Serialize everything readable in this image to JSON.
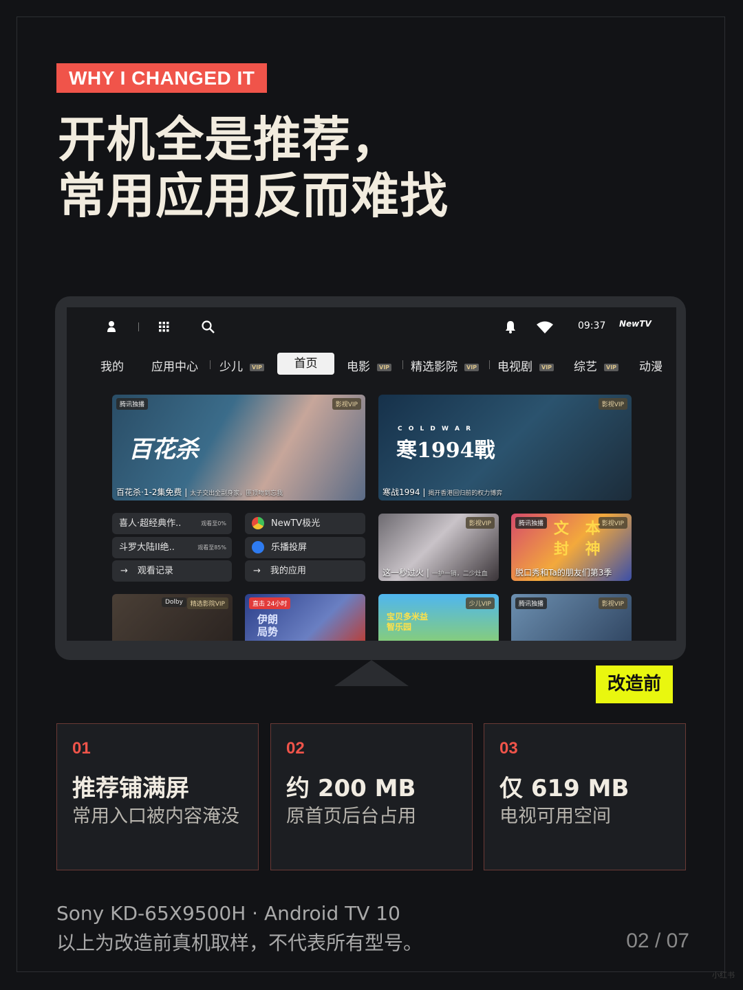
{
  "header": {
    "tag": "WHY I CHANGED IT",
    "headline_line1": "开机全是推荐，",
    "headline_line2": "常用应用反而难找"
  },
  "tv": {
    "status": {
      "time": "09:37",
      "brand": "NewTV"
    },
    "tabs": [
      {
        "label": "我的",
        "vip": ""
      },
      {
        "label": "应用中心",
        "vip": ""
      },
      {
        "label": "少儿",
        "vip": "VIP"
      },
      {
        "label": "首页",
        "vip": "",
        "active": true
      },
      {
        "label": "电影",
        "vip": "VIP"
      },
      {
        "label": "精选影院",
        "vip": "VIP"
      },
      {
        "label": "电视剧",
        "vip": "VIP"
      },
      {
        "label": "综艺",
        "vip": "VIP"
      },
      {
        "label": "动漫",
        "vip": ""
      }
    ],
    "hero_cards": [
      {
        "badge_left": "腾讯独播",
        "badge_right": "影视VIP",
        "poster_text": "百花杀",
        "caption": "百花杀·1-2集免费",
        "caption_sub": "太子交出全副身家，匪顶吻到忘我"
      },
      {
        "badge_right": "影视VIP",
        "poster_text": "寒1994戰",
        "poster_small": "C O L D   W A R",
        "caption": "寒战1994",
        "caption_sub": "揭开香港回归前的权力博弈"
      }
    ],
    "history": [
      {
        "label": "喜人·超经典作..",
        "progress": "观看至0%"
      },
      {
        "label": "斗罗大陆II绝..",
        "progress": "观看至85%"
      },
      {
        "label": "观看记录",
        "arrow": "→"
      }
    ],
    "apps": [
      {
        "label": "NewTV极光"
      },
      {
        "label": "乐播投屏"
      },
      {
        "label": "我的应用",
        "arrow": "→"
      }
    ],
    "small_cards": [
      {
        "badge_right": "影视VIP",
        "caption": "这一秒过火",
        "caption_sub": "一护一销，二少灶血"
      },
      {
        "badge_left": "腾讯独播",
        "badge_right": "影视VIP",
        "poster_text": "文 本 封 神",
        "caption": "脱口秀和Ta的朋友们第3季"
      }
    ],
    "bottom_cards": [
      {
        "badge_left": "Dolby",
        "badge_right": "精选影院VIP"
      },
      {
        "badge_left": "直击 24小时",
        "poster_text": "伊朗局势"
      },
      {
        "badge_right": "少儿VIP",
        "poster_text": "宝贝多米益智乐园"
      },
      {
        "badge_left": "腾讯独播",
        "badge_right": "影视VIP"
      }
    ]
  },
  "before_badge": "改造前",
  "stats": [
    {
      "num": "01",
      "big": "推荐铺满屏",
      "sub": "常用入口被内容淹没"
    },
    {
      "num": "02",
      "big": "约 200 MB",
      "sub": "原首页后台占用"
    },
    {
      "num": "03",
      "big": "仅 619 MB",
      "sub": "电视可用空间"
    }
  ],
  "footer": {
    "device": "Sony KD-65X9500H · Android TV 10",
    "note": "以上为改造前真机取样，不代表所有型号。",
    "page": "02 / 07"
  },
  "watermark": "小红书",
  "colors": {
    "accent": "#f0544a",
    "badge_yellow": "#e9f70f",
    "headline": "#f2ecdf",
    "background": "#121316"
  }
}
